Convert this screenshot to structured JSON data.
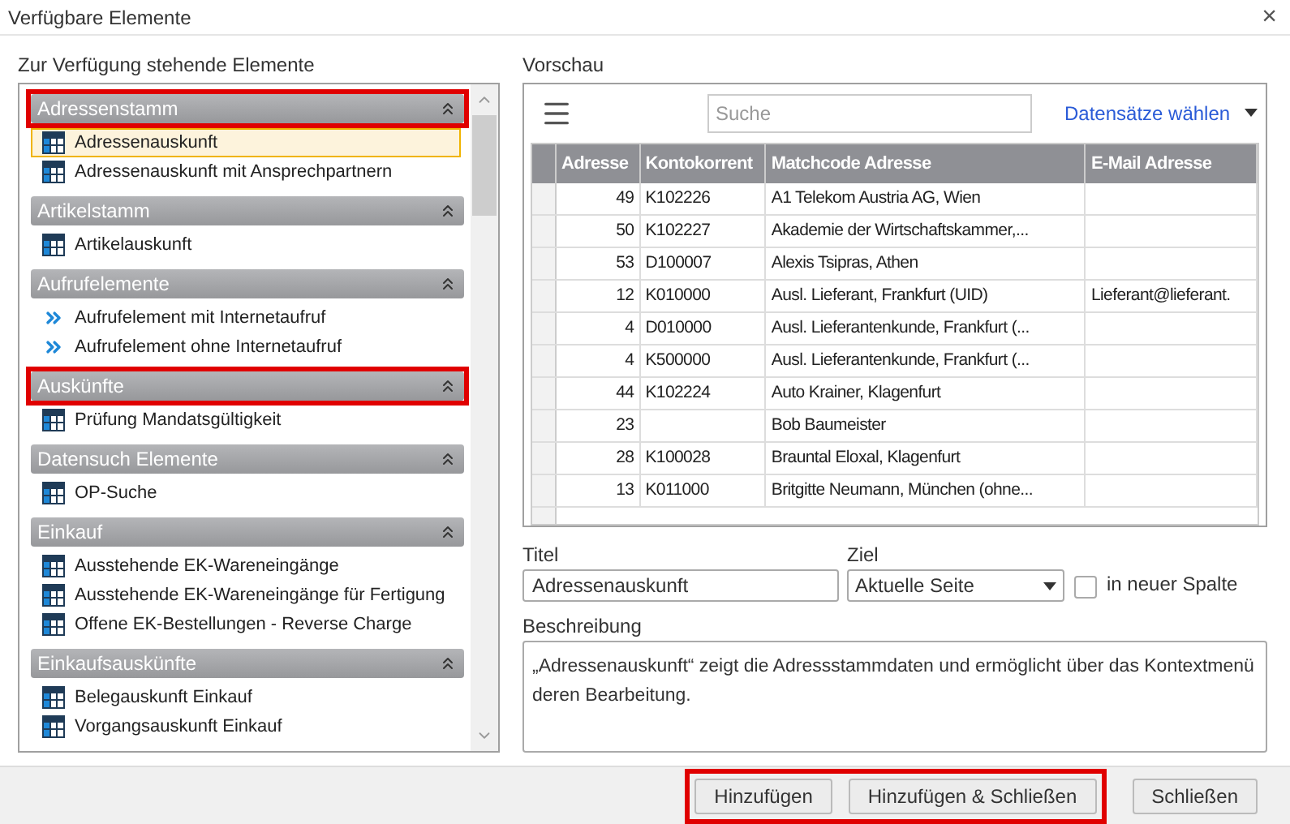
{
  "window": {
    "title": "Verfügbare Elemente",
    "close": "×"
  },
  "left": {
    "label": "Zur Verfügung stehende Elemente",
    "groups": [
      {
        "title": "Adressenstamm",
        "highlighted": true,
        "items": [
          {
            "label": "Adressenauskunft",
            "kind": "table",
            "selected": true
          },
          {
            "label": "Adressenauskunft mit Ansprechpartnern",
            "kind": "table",
            "selected": false
          }
        ]
      },
      {
        "title": "Artikelstamm",
        "highlighted": false,
        "items": [
          {
            "label": "Artikelauskunft",
            "kind": "table",
            "selected": false
          }
        ]
      },
      {
        "title": "Aufrufelemente",
        "highlighted": false,
        "items": [
          {
            "label": "Aufrufelement mit Internetaufruf",
            "kind": "link",
            "selected": false
          },
          {
            "label": "Aufrufelement ohne Internetaufruf",
            "kind": "link",
            "selected": false
          }
        ]
      },
      {
        "title": "Auskünfte",
        "highlighted": true,
        "items": [
          {
            "label": "Prüfung Mandatsgültigkeit",
            "kind": "table",
            "selected": false
          }
        ]
      },
      {
        "title": "Datensuch Elemente",
        "highlighted": false,
        "items": [
          {
            "label": "OP-Suche",
            "kind": "table",
            "selected": false
          }
        ]
      },
      {
        "title": "Einkauf",
        "highlighted": false,
        "items": [
          {
            "label": "Ausstehende EK-Wareneingänge",
            "kind": "table",
            "selected": false
          },
          {
            "label": "Ausstehende EK-Wareneingänge für Fertigung",
            "kind": "table",
            "selected": false
          },
          {
            "label": "Offene EK-Bestellungen - Reverse Charge",
            "kind": "table",
            "selected": false
          }
        ]
      },
      {
        "title": "Einkaufsauskünfte",
        "highlighted": false,
        "items": [
          {
            "label": "Belegauskunft Einkauf",
            "kind": "table",
            "selected": false
          },
          {
            "label": "Vorgangsauskunft Einkauf",
            "kind": "table",
            "selected": false
          }
        ]
      }
    ]
  },
  "preview": {
    "label": "Vorschau",
    "search": {
      "placeholder": "Suche"
    },
    "records_link": "Datensätze wählen",
    "table": {
      "columns": [
        "Adresse",
        "Kontokorrent",
        "Matchcode Adresse",
        "E-Mail Adresse"
      ],
      "rows": [
        [
          "49",
          "K102226",
          "A1 Telekom Austria AG, Wien",
          ""
        ],
        [
          "50",
          "K102227",
          "Akademie der Wirtschaftskammer,...",
          ""
        ],
        [
          "53",
          "D100007",
          "Alexis Tsipras, Athen",
          ""
        ],
        [
          "12",
          "K010000",
          "Ausl. Lieferant, Frankfurt (UID)",
          "Lieferant@lieferant."
        ],
        [
          "4",
          "D010000",
          "Ausl. Lieferantenkunde, Frankfurt (...",
          ""
        ],
        [
          "4",
          "K500000",
          "Ausl. Lieferantenkunde, Frankfurt (...",
          ""
        ],
        [
          "44",
          "K102224",
          "Auto Krainer, Klagenfurt",
          ""
        ],
        [
          "23",
          "",
          "Bob Baumeister",
          ""
        ],
        [
          "28",
          "K100028",
          "Brauntal Eloxal, Klagenfurt",
          ""
        ],
        [
          "13",
          "K011000",
          "Britgitte Neumann, München (ohne...",
          ""
        ]
      ]
    }
  },
  "form": {
    "title_label": "Titel",
    "title_value": "Adressenauskunft",
    "target_label": "Ziel",
    "target_value": "Aktuelle Seite",
    "new_column": {
      "label": "in neuer Spalte",
      "checked": false
    },
    "description_label": "Beschreibung",
    "description": "„Adressenauskunft“ zeigt die Adressstammdaten und ermöglicht über das Kontextmenü deren Bearbeitung."
  },
  "buttons": [
    {
      "label": "Hinzufügen",
      "highlighted": true
    },
    {
      "label": "Hinzufügen & Schließen",
      "highlighted": true
    },
    {
      "label": "Schließen",
      "highlighted": false
    }
  ]
}
